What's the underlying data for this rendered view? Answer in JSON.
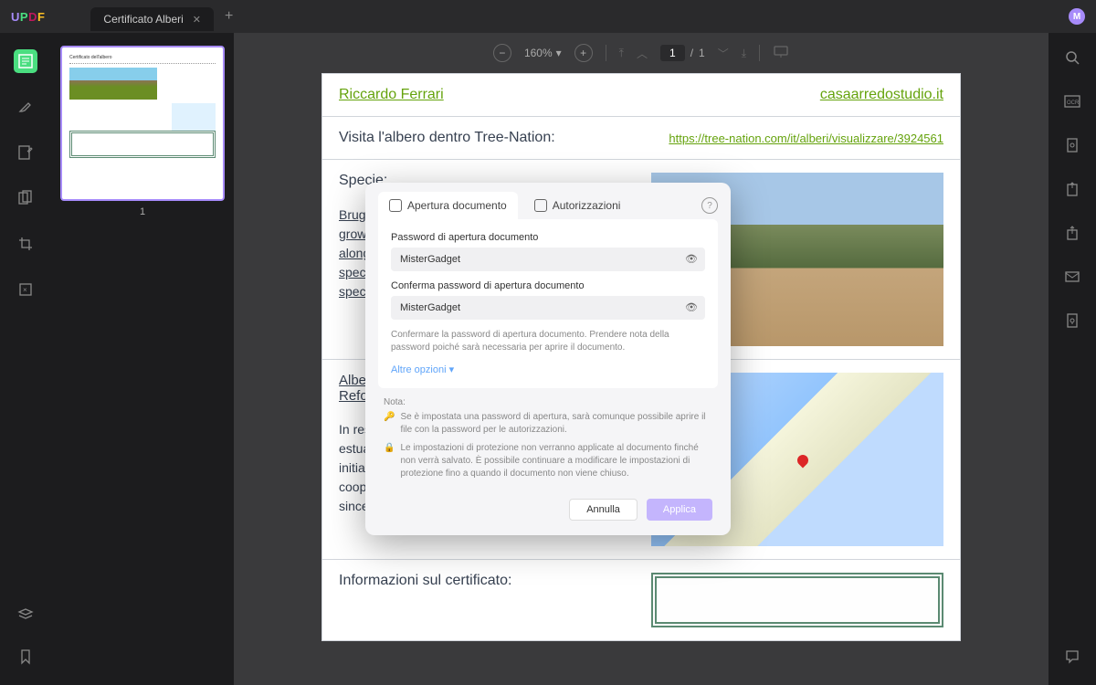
{
  "titlebar": {
    "logo": "UPDF",
    "tab": "Certificato Alberi",
    "avatar": "M"
  },
  "toolbar": {
    "zoom": "160%",
    "page_current": "1",
    "page_sep": "/",
    "page_total": "1"
  },
  "thumbs": {
    "num": "1"
  },
  "doc": {
    "author": "Riccardo Ferrari",
    "site": "casaarredostudio.it",
    "visit_label": "Visita l'albero dentro Tree-Nation:",
    "visit_url": "https://tree-nation.com/it/alberi/visualizzare/3924561",
    "species_label": "Specie:",
    "species_desc": "Bruguiera Gymnorhiza is a mangrove tree that grows in many protected coastal areas, especially along rivers and estuaries. It is a very important species being one of the main mangrove forest species.",
    "project_label": "Albero(i) piantato(i) nel progetto: Eden Reforestation – Madagascar",
    "project_desc": "In response to the destruction of mangrove estuaries and upland forests in Madagascar, Eden initiated the Madagascar Reforestation Project. The cooperation with Tree-Nation began in 2019 and since its inc...",
    "cert_label": "Informazioni sul certificato:"
  },
  "modal": {
    "tab1": "Apertura documento",
    "tab2": "Autorizzazioni",
    "pw_label": "Password di apertura documento",
    "pw_value": "MisterGadget",
    "pw2_label": "Conferma password di apertura documento",
    "pw2_value": "MisterGadget",
    "pw2_help": "Confermare la password di apertura documento. Prendere nota della password poiché sarà necessaria per aprire il documento.",
    "more": "Altre opzioni",
    "note_title": "Nota:",
    "note1": "Se è impostata una password di apertura, sarà comunque possibile aprire il file con la password per le autorizzazioni.",
    "note2": "Le impostazioni di protezione non verranno applicate al documento finché non verrà salvato. È possibile continuare a modificare le impostazioni di protezione fino a quando il documento non viene chiuso.",
    "cancel": "Annulla",
    "apply": "Applica"
  }
}
